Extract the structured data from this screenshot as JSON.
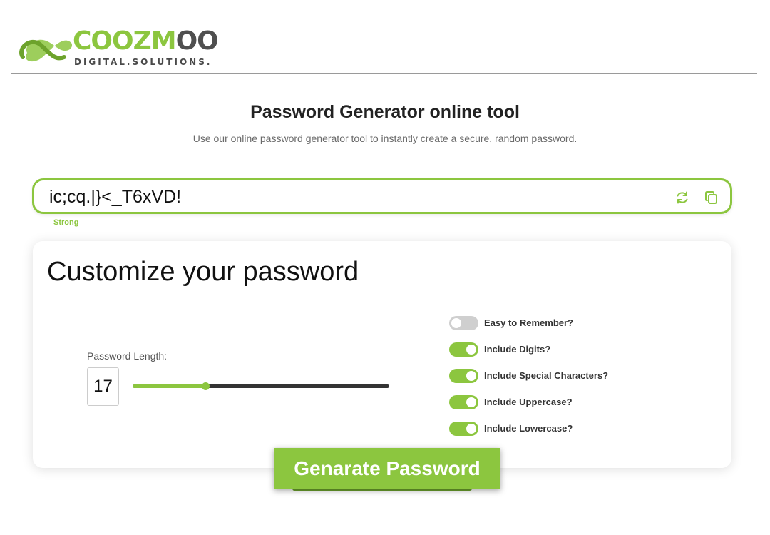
{
  "header": {
    "brand": {
      "part1": "COOZM",
      "part2": "OO",
      "tagline": "DIGITAL.SOLUTIONS."
    }
  },
  "page": {
    "title": "Password Generator online tool",
    "subtitle": "Use our online password generator tool to instantly create a secure, random password."
  },
  "password": {
    "value": "ic;cq.|}<_T6xVD!",
    "strength": "Strong",
    "icons": [
      "refresh-icon",
      "copy-icon"
    ]
  },
  "customize": {
    "title": "Customize your password",
    "length_label": "Password Length:",
    "length_value": "17",
    "slider": {
      "min": 4,
      "max": 50,
      "value": 17
    },
    "options": [
      {
        "label": "Easy to Remember?",
        "on": false
      },
      {
        "label": "Include Digits?",
        "on": true
      },
      {
        "label": "Include Special Characters?",
        "on": true
      },
      {
        "label": "Include Uppercase?",
        "on": true
      },
      {
        "label": "Include Lowercase?",
        "on": true
      }
    ]
  },
  "generate_button": {
    "label": "Genarate Password"
  },
  "colors": {
    "accent": "#8cc63f",
    "dark": "#333333",
    "toggle_off": "#cfcfcf"
  }
}
